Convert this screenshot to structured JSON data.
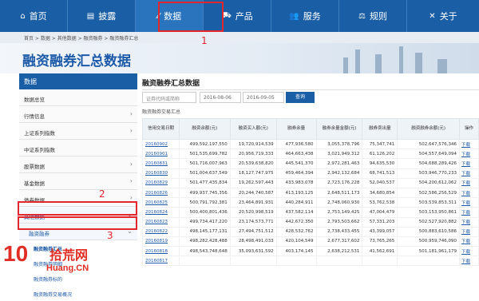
{
  "nav": {
    "items": [
      {
        "label": "首页",
        "icon": "home-icon",
        "glyph": "⌂"
      },
      {
        "label": "披露",
        "icon": "doc-icon",
        "glyph": "▤"
      },
      {
        "label": "数据",
        "icon": "chart-icon",
        "glyph": "⁄⁄"
      },
      {
        "label": "产品",
        "icon": "cart-icon",
        "glyph": "⛟"
      },
      {
        "label": "服务",
        "icon": "users-icon",
        "glyph": "👥"
      },
      {
        "label": "规则",
        "icon": "gavel-icon",
        "glyph": "⚖"
      },
      {
        "label": "关于",
        "icon": "cross-icon",
        "glyph": "✕"
      }
    ]
  },
  "annotations": {
    "one": "1",
    "two": "2",
    "three": "3"
  },
  "breadcrumb": "首页 > 数据 > 其他数据 > 融资融券 > 融资融券汇总",
  "banner_title": "融资融券汇总数据",
  "sidebar": {
    "heading": "数据",
    "items": [
      {
        "label": "数据总览",
        "arrow": ""
      },
      {
        "label": "行情信息",
        "arrow": "›"
      },
      {
        "label": "上证系列指数",
        "arrow": "›"
      },
      {
        "label": "中证系列指数",
        "arrow": ""
      },
      {
        "label": "股票数据",
        "arrow": "›"
      },
      {
        "label": "基金数据",
        "arrow": "›"
      },
      {
        "label": "债券数据",
        "arrow": "›"
      },
      {
        "label": "其他数据",
        "arrow": "⌄"
      },
      {
        "label": "融资融券",
        "arrow": "⌄"
      }
    ],
    "subitems": [
      "融资融券汇总",
      "融资融券明细",
      "融资融券标的",
      "融资融券交易概况"
    ]
  },
  "content": {
    "title": "融资融券汇总数据",
    "search_placeholder": "证券代码或简称",
    "date_start": "2016-08-06",
    "date_end": "2016-09-05",
    "query_label": "查询",
    "subtitle": "融资融券交易汇总",
    "headers": [
      "信用交易日期",
      "融资余额(元)",
      "融资买入额(元)",
      "融券余量",
      "融券余量金额(元)",
      "融券卖出量",
      "融资融券余额(元)",
      "操作"
    ],
    "rows": [
      [
        "20160902",
        "499,592,197,550",
        "19,720,914,539",
        "477,936,580",
        "3,055,378,796",
        "75,347,741",
        "502,647,576,346",
        "下载"
      ],
      [
        "20160901",
        "501,535,699,782",
        "20,956,719,333",
        "464,663,438",
        "3,021,949,312",
        "61,126,202",
        "504,557,649,094",
        "下载"
      ],
      [
        "20160831",
        "501,716,007,963",
        "20,539,638,820",
        "445,541,370",
        "2,972,281,463",
        "94,635,530",
        "504,688,289,426",
        "下载"
      ],
      [
        "20160830",
        "501,004,637,549",
        "18,127,747,975",
        "459,464,394",
        "2,942,132,684",
        "68,741,513",
        "503,946,770,233",
        "下载"
      ],
      [
        "20160829",
        "501,477,435,834",
        "19,262,597,443",
        "433,983,078",
        "2,723,176,228",
        "52,040,537",
        "504,200,612,062",
        "下载"
      ],
      [
        "20160826",
        "499,937,745,356",
        "20,244,740,587",
        "413,193,125",
        "2,648,511,173",
        "34,680,854",
        "502,586,256,529",
        "下载"
      ],
      [
        "20160825",
        "500,791,792,381",
        "23,464,891,931",
        "440,284,911",
        "2,748,060,930",
        "53,762,538",
        "503,539,853,311",
        "下载"
      ],
      [
        "20160824",
        "500,400,801,436",
        "20,520,998,519",
        "437,582,114",
        "2,753,149,425",
        "47,004,479",
        "503,153,950,861",
        "下载"
      ],
      [
        "20160823",
        "499,734,417,220",
        "23,174,573,771",
        "442,672,350",
        "2,793,503,662",
        "57,331,203",
        "502,527,920,882",
        "下载"
      ],
      [
        "20160822",
        "498,145,177,131",
        "27,494,751,512",
        "428,532,762",
        "2,738,433,455",
        "43,399,057",
        "500,883,610,586",
        "下载"
      ],
      [
        "20160819",
        "498,282,428,488",
        "28,498,491,033",
        "420,104,549",
        "2,677,317,602",
        "73,765,265",
        "500,959,746,090",
        "下载"
      ],
      [
        "20160818",
        "498,543,748,648",
        "35,093,631,592",
        "403,174,145",
        "2,638,212,531",
        "41,562,691",
        "501,181,961,179",
        "下载"
      ],
      [
        "20160817",
        "",
        "",
        "",
        "",
        "",
        "",
        "下载"
      ]
    ]
  },
  "watermark": {
    "number": "10",
    "name": "拾荒网",
    "url": "Huang.CN"
  },
  "colors": {
    "nav": "#1a5fa6",
    "accent_red": "#e3262c",
    "link": "#1d5aa8"
  }
}
